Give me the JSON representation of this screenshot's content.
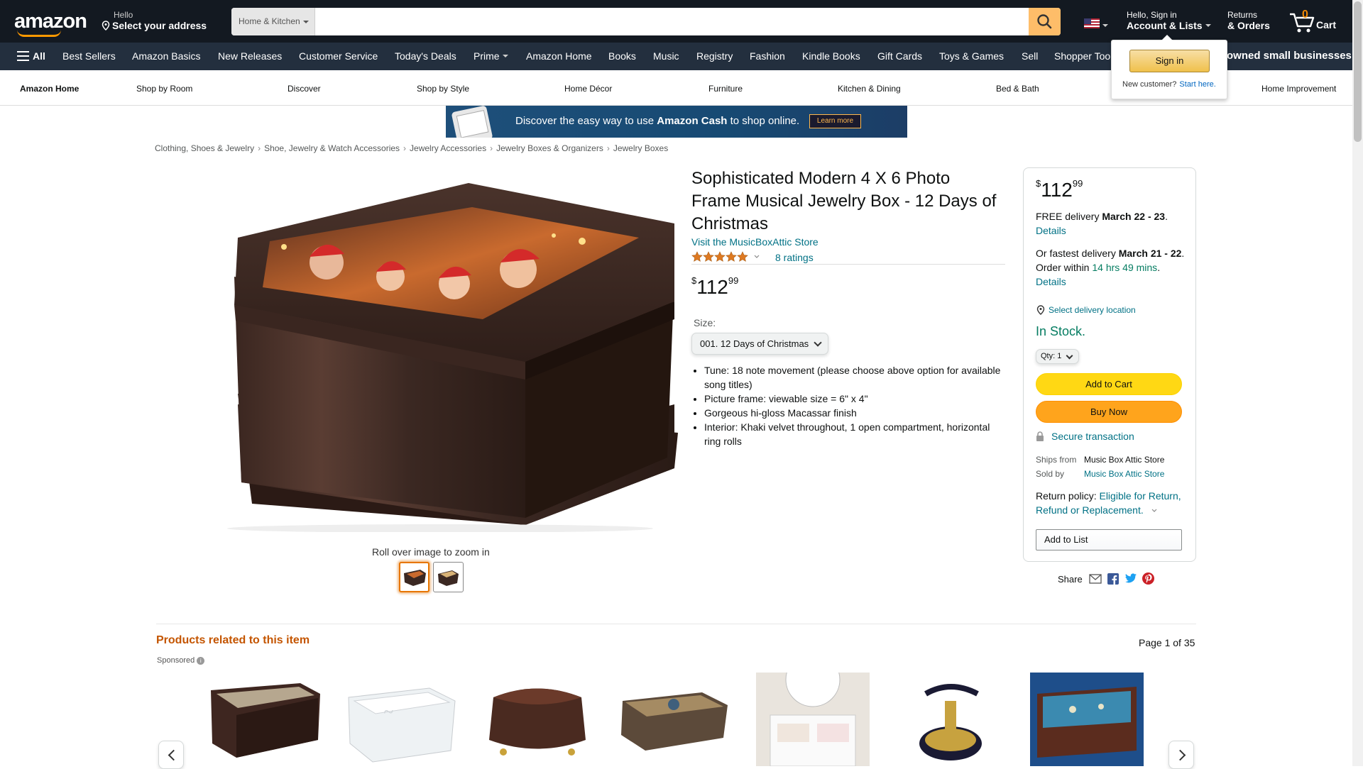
{
  "header": {
    "logo": "amazon",
    "deliver_line1": "Hello",
    "deliver_line2": "Select your address",
    "search_category": "Home & Kitchen",
    "search_placeholder": "",
    "account_line1": "Hello, Sign in",
    "account_line2": "Account & Lists",
    "returns_line1": "Returns",
    "returns_line2": "& Orders",
    "cart_count": "0",
    "cart_label": "Cart"
  },
  "nav": {
    "all": "All",
    "items": [
      "Best Sellers",
      "Amazon Basics",
      "New Releases",
      "Customer Service",
      "Today's Deals",
      "Prime",
      "Amazon Home",
      "Books",
      "Music",
      "Registry",
      "Fashion",
      "Kindle Books",
      "Gift Cards",
      "Toys & Games",
      "Sell",
      "Shopper Toolkit"
    ],
    "promo": "owned small businesses"
  },
  "subnav": {
    "items": [
      "Amazon Home",
      "Shop by Room",
      "Discover",
      "Shop by Style",
      "Home Décor",
      "Furniture",
      "Kitchen & Dining",
      "Bed & Bath",
      "",
      "Home Improvement"
    ]
  },
  "flyout": {
    "signin": "Sign in",
    "new_customer": "New customer?",
    "start_here": "Start here."
  },
  "banner": {
    "text_plain": "Discover the easy way to use ",
    "text_bold": "Amazon Cash",
    "text_end": " to shop online.",
    "button": "Learn more"
  },
  "breadcrumb": [
    "Clothing, Shoes & Jewelry",
    "Shoe, Jewelry & Watch Accessories",
    "Jewelry Accessories",
    "Jewelry Boxes & Organizers",
    "Jewelry Boxes"
  ],
  "gallery": {
    "rollover": "Roll over image to zoom in"
  },
  "product": {
    "title": "Sophisticated Modern 4 X 6 Photo Frame Musical Jewelry Box - 12 Days of Christmas",
    "store": "Visit the MusicBoxAttic Store",
    "rating_value": 5,
    "ratings": "8 ratings",
    "price_symbol": "$",
    "price_whole": "112",
    "price_fraction": "99",
    "size_label": "Size:",
    "size_value": "001. 12 Days of Christmas",
    "bullets": [
      "Tune: 18 note movement (please choose above option for available song titles)",
      "Picture frame: viewable size = 6\" x 4\"",
      "Gorgeous hi-gloss Macassar finish",
      "Interior: Khaki velvet throughout, 1 open compartment, horizontal ring rolls"
    ]
  },
  "buybox": {
    "price_symbol": "$",
    "price_whole": "112",
    "price_fraction": "99",
    "free_delivery": "FREE delivery ",
    "free_delivery_date": "March 22 - 23",
    "details": "Details",
    "fastest": "Or fastest delivery ",
    "fastest_date": "March 21 - 22",
    "order_within": ". Order within ",
    "countdown": "14 hrs 49 mins",
    "delivery_location": "Select delivery location",
    "stock": "In Stock.",
    "qty": "Qty: 1",
    "add_to_cart": "Add to Cart",
    "buy_now": "Buy Now",
    "secure": "Secure transaction",
    "ships_from_label": "Ships from",
    "ships_from": "Music Box Attic Store",
    "sold_by_label": "Sold by",
    "sold_by": "Music Box Attic Store",
    "return_label": "Return policy: ",
    "return_link": "Eligible for Return, Refund or Replacement.",
    "add_to_list": "Add to List",
    "share": "Share"
  },
  "related": {
    "title": "Products related to this item",
    "page": "Page 1 of 35",
    "sponsored": "Sponsored"
  },
  "colors": {
    "header_bg": "#131921",
    "nav_bg": "#232f3e",
    "accent": "#ff9900",
    "link": "#007185",
    "in_stock": "#067d62",
    "add_to_cart": "#ffd814",
    "buy_now": "#ffa41c"
  }
}
